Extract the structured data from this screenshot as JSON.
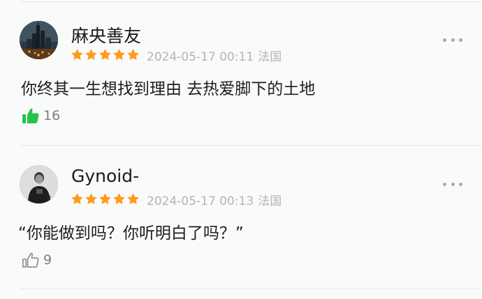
{
  "colors": {
    "star": "#ff9a1f",
    "like_active": "#27c24a",
    "meta_text": "#b4b4b4"
  },
  "comments": [
    {
      "username": "麻央善友",
      "rating": 5,
      "date": "2024-05-17 00:11",
      "location": "法国",
      "text": "你终其一生想找到理由 去热爱脚下的土地",
      "likes": "16",
      "liked": true,
      "avatar_icon": "city-night-avatar"
    },
    {
      "username": "Gynoid-",
      "rating": 5,
      "date": "2024-05-17 00:13",
      "location": "法国",
      "text": "“你能做到吗？你听明白了吗？”",
      "likes": "9",
      "liked": false,
      "avatar_icon": "person-avatar"
    }
  ]
}
